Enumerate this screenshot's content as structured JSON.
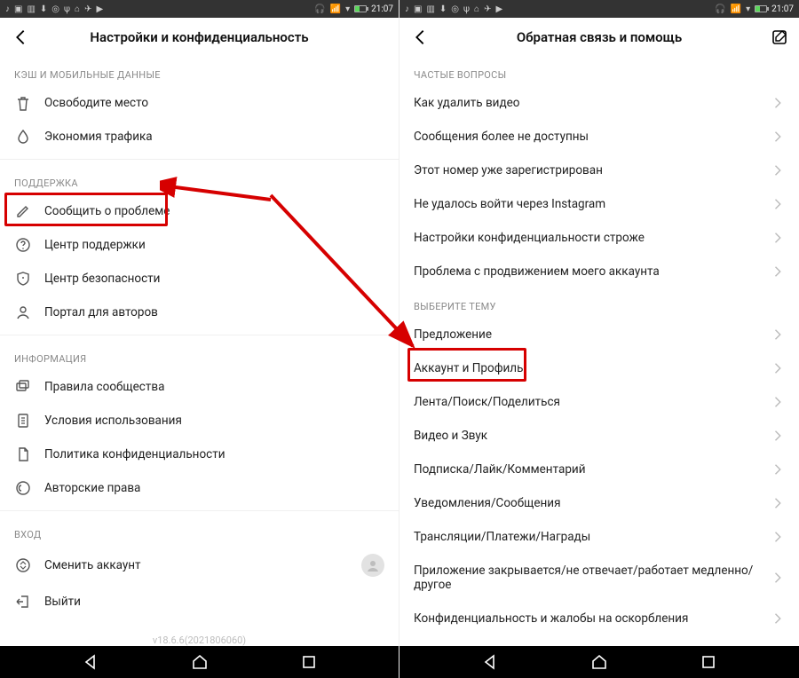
{
  "status": {
    "time": "21:07"
  },
  "left": {
    "title": "Настройки и конфиденциальность",
    "cache_header": "КЭШ И МОБИЛЬНЫЕ ДАННЫЕ",
    "free_space": "Освободите место",
    "data_saver": "Экономия трафика",
    "support_header": "ПОДДЕРЖКА",
    "report_problem": "Сообщить о проблеме",
    "help_center": "Центр поддержки",
    "safety_center": "Центр безопасности",
    "creator_portal": "Портал для авторов",
    "info_header": "ИНФОРМАЦИЯ",
    "community_guidelines": "Правила сообщества",
    "terms": "Условия использования",
    "privacy_policy": "Политика конфиденциальности",
    "copyright": "Авторские права",
    "login_header": "ВХОД",
    "switch_account": "Сменить аккаунт",
    "logout": "Выйти",
    "version": "v18.6.6(2021806060)"
  },
  "right": {
    "title": "Обратная связь и помощь",
    "faq_header": "ЧАСТЫЕ ВОПРОСЫ",
    "faq": {
      "delete_video": "Как удалить видео",
      "msg_unavailable": "Сообщения более не доступны",
      "number_registered": "Этот номер уже зарегистрирован",
      "instagram_login": "Не удалось войти через Instagram",
      "privacy_stricter": "Настройки конфиденциальности строже",
      "promo_problem": "Проблема с продвижением моего аккаунта"
    },
    "topic_header": "ВЫБЕРИТЕ ТЕМУ",
    "topic": {
      "suggestion": "Предложение",
      "account_profile": "Аккаунт и Профиль",
      "feed_search_share": "Лента/Поиск/Поделиться",
      "video_sound": "Видео и Звук",
      "sub_like_comment": "Подписка/Лайк/Комментарий",
      "notifications": "Уведомления/Сообщения",
      "streams": "Трансляции/Платежи/Награды",
      "app_issues": "Приложение закрывается/не отвечает/работает медленно/другое",
      "privacy_abuse": "Конфиденциальность и жалобы на оскорбления"
    }
  }
}
